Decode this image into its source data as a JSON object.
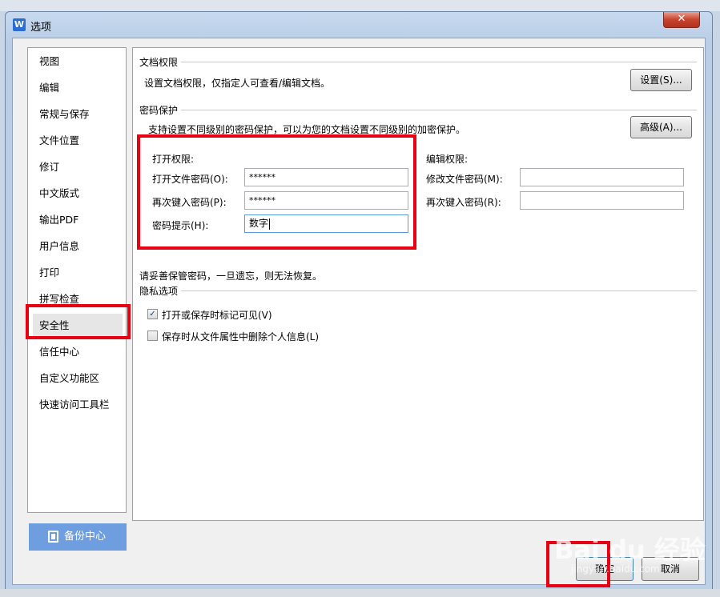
{
  "window": {
    "title": "选项",
    "app_icon_letter": "W",
    "close_glyph": "✕"
  },
  "sidebar": {
    "items": [
      {
        "label": "视图"
      },
      {
        "label": "编辑"
      },
      {
        "label": "常规与保存"
      },
      {
        "label": "文件位置"
      },
      {
        "label": "修订"
      },
      {
        "label": "中文版式"
      },
      {
        "label": "输出PDF"
      },
      {
        "label": "用户信息"
      },
      {
        "label": "打印"
      },
      {
        "label": "拼写检查"
      },
      {
        "label": "安全性",
        "selected": true
      },
      {
        "label": "信任中心"
      },
      {
        "label": "自定义功能区"
      },
      {
        "label": "快速访问工具栏"
      }
    ],
    "backup_label": "备份中心"
  },
  "doc_permission": {
    "group_title": "文档权限",
    "description": "设置文档权限，仅指定人可查看/编辑文档。",
    "settings_button": "设置(S)..."
  },
  "password": {
    "group_title": "密码保护",
    "description": "支持设置不同级别的密码保护，可以为您的文档设置不同级别的加密保护。",
    "advanced_button": "高级(A)...",
    "open": {
      "title": "打开权限:",
      "password_label": "打开文件密码(O):",
      "password_value": "******",
      "confirm_label": "再次键入密码(P):",
      "confirm_value": "******",
      "hint_label": "密码提示(H):",
      "hint_value": "数字"
    },
    "edit": {
      "title": "编辑权限:",
      "password_label": "修改文件密码(M):",
      "password_value": "",
      "confirm_label": "再次键入密码(R):",
      "confirm_value": ""
    },
    "warning": "请妥善保管密码，一旦遗忘，则无法恢复。"
  },
  "privacy": {
    "group_title": "隐私选项",
    "options": [
      {
        "label": "打开或保存时标记可见(V)",
        "checked": true
      },
      {
        "label": "保存时从文件属性中删除个人信息(L)",
        "checked": false
      }
    ]
  },
  "footer": {
    "ok_label": "确定",
    "cancel_label": "取消"
  },
  "watermark": {
    "brand": "Bai du 经验",
    "url": "jingyan.baidu.com"
  },
  "colors": {
    "highlight_box": "#e60012",
    "backup_button": "#6f9ee0"
  }
}
